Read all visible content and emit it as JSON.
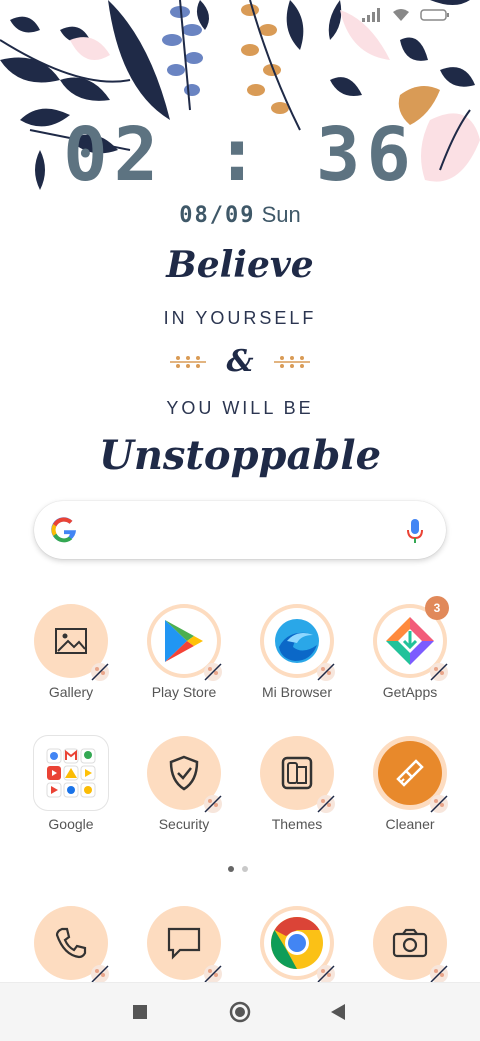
{
  "clock": {
    "time": "02 : 36"
  },
  "date": {
    "daymonth": "08/09",
    "weekday": "Sun"
  },
  "quote": {
    "line1": "Believe",
    "line2": "IN YOURSELF",
    "line3": "&",
    "line4": "YOU WILL BE",
    "line5": "Unstoppable"
  },
  "apps_row1": [
    {
      "label": "Gallery"
    },
    {
      "label": "Play Store"
    },
    {
      "label": "Mi Browser"
    },
    {
      "label": "GetApps",
      "badge": "3"
    }
  ],
  "apps_row2": [
    {
      "label": "Google"
    },
    {
      "label": "Security"
    },
    {
      "label": "Themes"
    },
    {
      "label": "Cleaner"
    }
  ],
  "dock": [
    {
      "icon": "phone-icon"
    },
    {
      "icon": "messages-icon"
    },
    {
      "icon": "chrome-icon"
    },
    {
      "icon": "camera-icon"
    }
  ],
  "colors": {
    "peach": "#fddcc0",
    "navy": "#1f2a47",
    "clock": "#5d7381",
    "badge": "#e1895a"
  }
}
